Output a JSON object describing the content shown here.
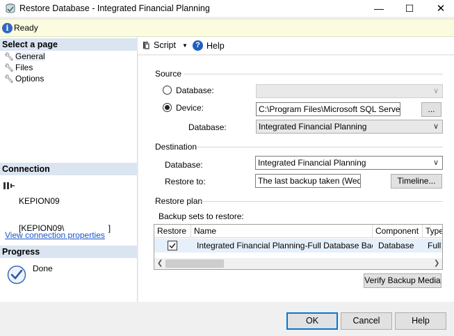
{
  "window": {
    "title": "Restore Database - Integrated Financial Planning",
    "min_glyph": "—",
    "max_glyph": "☐",
    "close_glyph": "✕"
  },
  "status": {
    "text": "Ready",
    "icon": "info-icon"
  },
  "left_pane": {
    "select_page_header": "Select a page",
    "pages": [
      {
        "label": "General",
        "selected": true
      },
      {
        "label": "Files",
        "selected": false
      },
      {
        "label": "Options",
        "selected": false
      }
    ],
    "connection_header": "Connection",
    "connection_line1": "KEPION09",
    "connection_line2": "[KEPION09\\                   ]",
    "view_connection_link": "View connection properties",
    "progress_header": "Progress",
    "progress_status": "Done"
  },
  "toolbar": {
    "script_label": "Script",
    "help_label": "Help"
  },
  "source": {
    "group_label": "Source",
    "database_radio_label": "Database:",
    "device_radio_label": "Device:",
    "device_path": "C:\\Program Files\\Microsoft SQL Server\\MS",
    "browse_label": "...",
    "database_label": "Database:",
    "database_value": "Integrated Financial Planning"
  },
  "destination": {
    "group_label": "Destination",
    "database_label": "Database:",
    "database_value": "Integrated Financial Planning",
    "restore_to_label": "Restore to:",
    "restore_to_value": "The last backup taken (Wedne",
    "timeline_label": "Timeline..."
  },
  "restore_plan": {
    "group_label": "Restore plan",
    "backup_sets_label": "Backup sets to restore:",
    "columns": [
      "Restore",
      "Name",
      "Component",
      "Type"
    ],
    "rows": [
      {
        "restore": true,
        "name": "Integrated Financial Planning-Full Database Backup",
        "component": "Database",
        "type": "Full"
      }
    ],
    "verify_label": "Verify Backup Media"
  },
  "footer": {
    "ok_label": "OK",
    "cancel_label": "Cancel",
    "help_label": "Help"
  },
  "colors": {
    "section_header": "#dbe5f1",
    "link": "#1a55c8",
    "status_bg": "#fbfbe0",
    "selected_row": "#e5f0fb",
    "default_button_border": "#0078d7"
  }
}
